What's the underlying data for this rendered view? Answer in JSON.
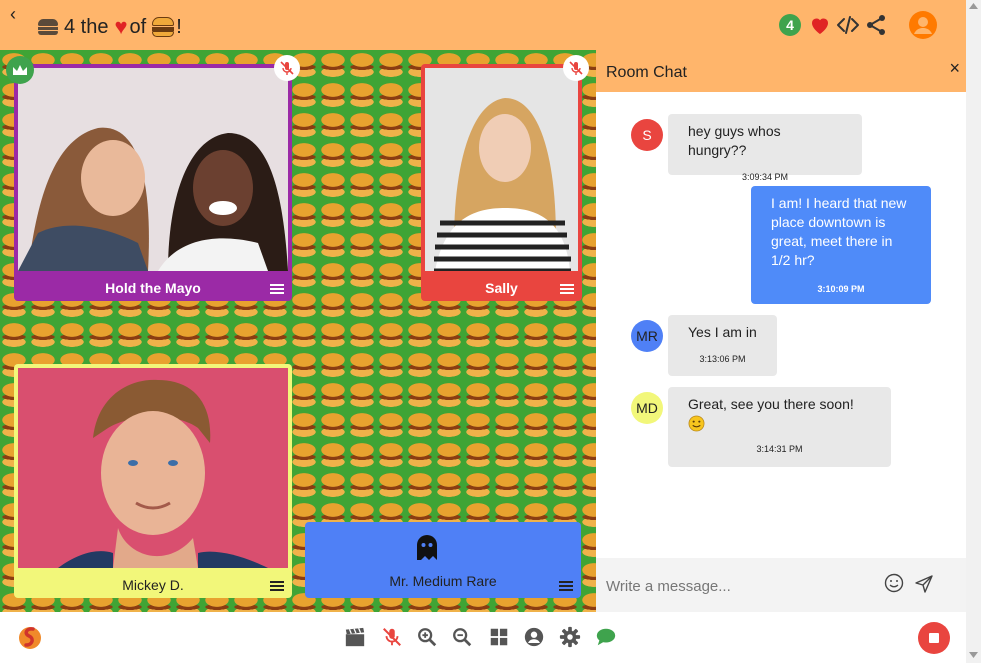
{
  "header": {
    "back_label": "‹",
    "title_prefix": "4 the",
    "title_of": "of",
    "title_suffix": "!",
    "participant_count": "4"
  },
  "tiles": [
    {
      "id": "mayo",
      "name": "Hold the Mayo"
    },
    {
      "id": "sally",
      "name": "Sally"
    },
    {
      "id": "mickey",
      "name": "Mickey D."
    },
    {
      "id": "medium",
      "name": "Mr. Medium Rare"
    }
  ],
  "chat": {
    "title": "Room Chat",
    "close_label": "×",
    "composer_placeholder": "Write a message...",
    "messages": [
      {
        "initials": "S",
        "text": "hey guys whos hungry??",
        "time": "3:09:34 PM",
        "mine": false,
        "avatar_color": "#e9453f",
        "initials_color": "#ffffff"
      },
      {
        "initials": "",
        "text": "I am! I heard that new place downtown is great, meet there in 1/2 hr?",
        "time": "3:10:09 PM",
        "mine": true
      },
      {
        "initials": "MR",
        "text": "Yes I am in",
        "time": "3:13:06 PM",
        "mine": false,
        "avatar_color": "#4f80f6",
        "initials_color": "#222222"
      },
      {
        "initials": "MD",
        "text": "Great, see you there soon!",
        "time": "3:14:31 PM",
        "mine": false,
        "avatar_color": "#f2f77a",
        "initials_color": "#222222"
      }
    ]
  },
  "colors": {
    "header": "#ffb56b",
    "accent_green": "#3fa34d",
    "accent_red": "#e9453f",
    "accent_blue": "#4f80f6",
    "accent_purple": "#9b2aa6",
    "accent_yellow": "#f2f77a"
  },
  "toolbar": {
    "icons": [
      "logo-icon",
      "clapperboard-icon",
      "mic-off-icon",
      "zoom-in-icon",
      "zoom-out-icon",
      "grid-icon",
      "account-icon",
      "gear-icon",
      "chat-icon",
      "record-icon"
    ]
  }
}
